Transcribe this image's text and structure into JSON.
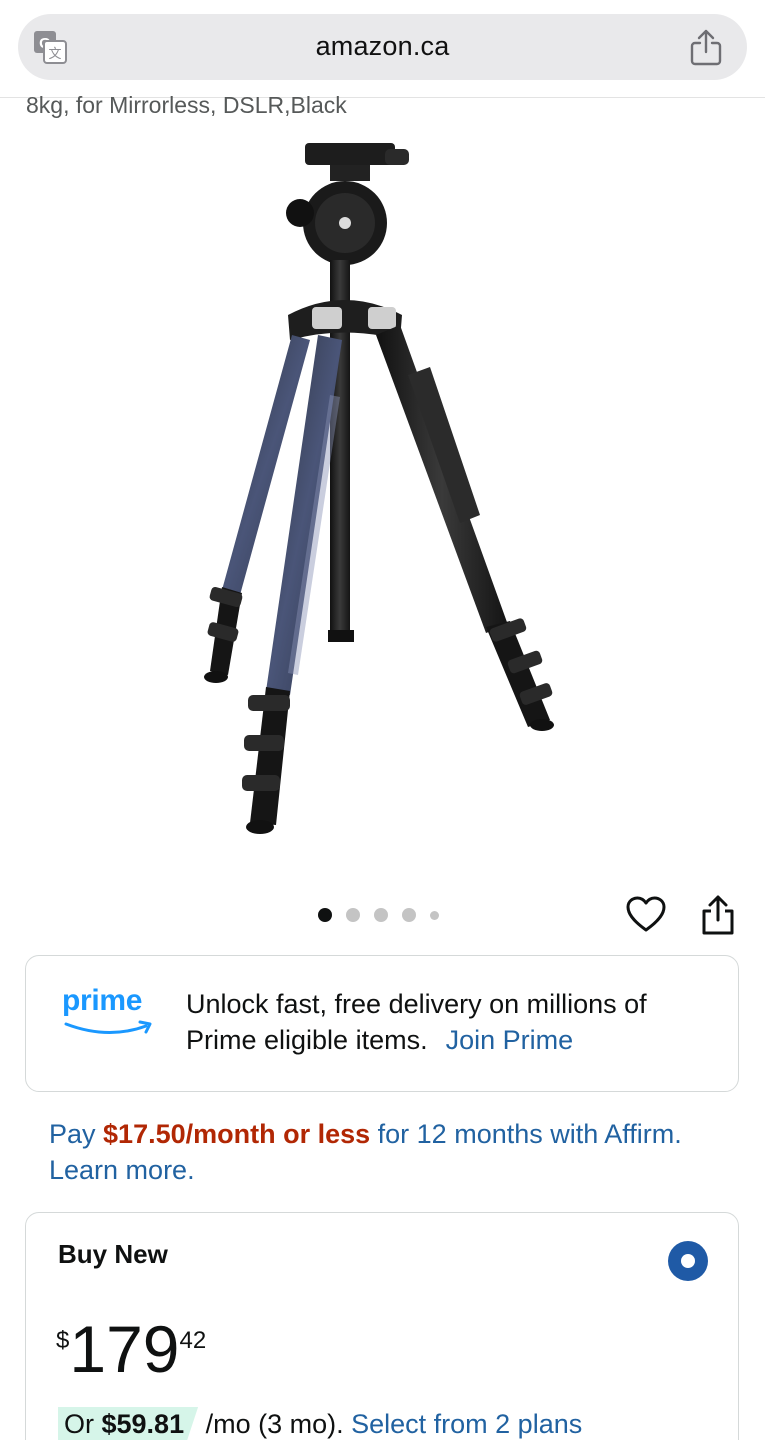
{
  "browser": {
    "domain": "amazon.ca",
    "translate_icon": "translate-icon",
    "share_icon": "share-icon"
  },
  "product": {
    "title_tail": "8kg, for Mirrorless, DSLR,Black",
    "image_alt_icon": "tripod-image",
    "carousel": {
      "count": 5,
      "active_index": 0
    }
  },
  "actions": {
    "wishlist_icon": "heart-icon",
    "share_icon": "share-icon"
  },
  "prime": {
    "logo_text": "prime",
    "message": "Unlock fast, free delivery on millions of Prime eligible items.",
    "link": "Join Prime",
    "brand_color": "#1a98ff"
  },
  "affirm": {
    "prefix": "Pay ",
    "amount": "$17.50/month or less",
    "suffix": " for 12 months with Affirm. Learn more."
  },
  "buy_new": {
    "title": "Buy New",
    "price_symbol": "$",
    "price_whole": "179",
    "price_fraction": "42",
    "plan_or": "Or ",
    "plan_amount": "$59.81",
    "plan_term": " /mo (3 mo). ",
    "plan_link": "Select from 2 plans"
  },
  "colors": {
    "link": "#2162a1",
    "price_accent": "#b12704",
    "radio": "#1f5aa6",
    "plan_badge": "#d6f5e9"
  }
}
